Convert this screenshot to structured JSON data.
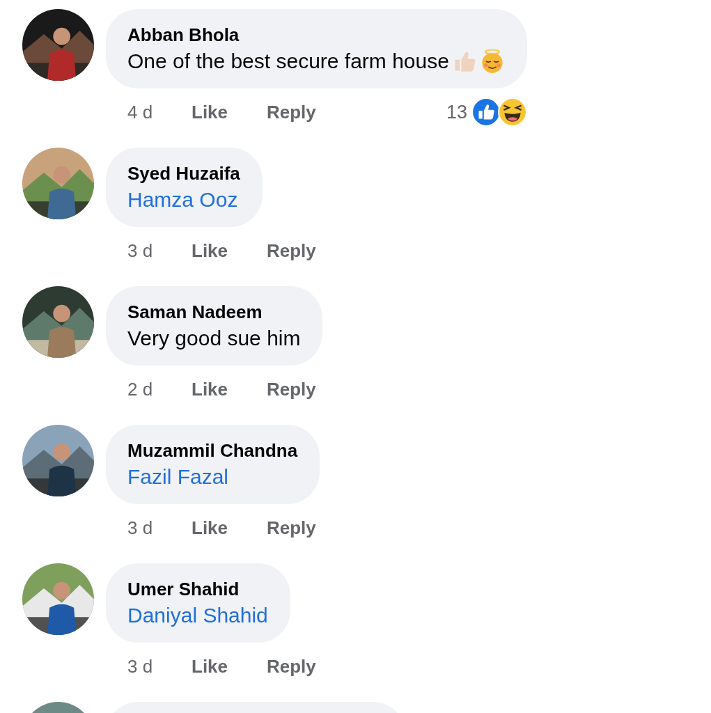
{
  "comments": [
    {
      "kind": "text",
      "name": "Abban Bhola",
      "text": "One of the best secure farm house",
      "text_emoji": [
        {
          "kind": "thumbs_up"
        },
        {
          "kind": "halo_face"
        }
      ],
      "time": "4 d",
      "like": "Like",
      "reply": "Reply",
      "reactions": {
        "count": "13",
        "types": [
          {
            "kind": "like"
          },
          {
            "kind": "haha"
          }
        ]
      }
    },
    {
      "kind": "mention",
      "name": "Syed Huzaifa",
      "text": "Hamza Ooz",
      "time": "3 d",
      "like": "Like",
      "reply": "Reply"
    },
    {
      "kind": "text",
      "name": "Saman Nadeem",
      "text": "Very good sue him",
      "time": "2 d",
      "like": "Like",
      "reply": "Reply"
    },
    {
      "kind": "mention",
      "name": "Muzammil Chandna",
      "text": "Fazil Fazal",
      "time": "3 d",
      "like": "Like",
      "reply": "Reply"
    },
    {
      "kind": "mention",
      "name": "Umer Shahid",
      "text": "Daniyal Shahid",
      "time": "3 d",
      "like": "Like",
      "reply": "Reply"
    },
    {
      "kind": "cut_off"
    }
  ]
}
